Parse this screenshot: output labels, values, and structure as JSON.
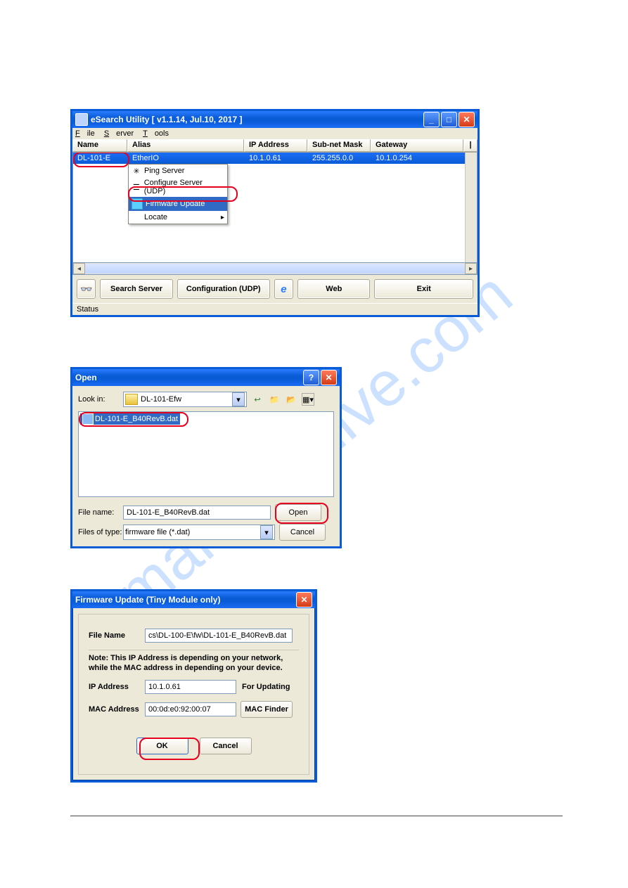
{
  "watermark": "manualshive.com",
  "win1": {
    "title": "eSearch Utility [ v1.1.14, Jul.10, 2017 ]",
    "menu": {
      "file": "File",
      "server": "Server",
      "tools": "Tools"
    },
    "columns": {
      "name": "Name",
      "alias": "Alias",
      "ip": "IP Address",
      "subnet": "Sub-net Mask",
      "gateway": "Gateway",
      "last": "|"
    },
    "row": {
      "name": "DL-101-E",
      "alias": "EtherIO",
      "ip": "10.1.0.61",
      "subnet": "255.255.0.0",
      "gateway": "10.1.0.254"
    },
    "context": {
      "ping": "Ping Server",
      "configure": "Configure Server (UDP)",
      "firmware": "Firmware Update",
      "locate": "Locate"
    },
    "buttons": {
      "search": "Search Server",
      "config": "Configuration (UDP)",
      "web": "Web",
      "exit": "Exit"
    },
    "status": "Status"
  },
  "win2": {
    "title": "Open",
    "lookin_label": "Look in:",
    "lookin_value": "DL-101-Efw",
    "file_selected": "DL-101-E_B40RevB.dat",
    "file_name_label": "File name:",
    "file_name_value": "DL-101-E_B40RevB.dat",
    "type_label": "Files of type:",
    "type_value": "firmware file (*.dat)",
    "open_btn": "Open",
    "cancel_btn": "Cancel"
  },
  "win3": {
    "title": "Firmware Update (Tiny Module only)",
    "file_name_label": "File Name",
    "file_name_value": "cs\\DL-100-E\\fw\\DL-101-E_B40RevB.dat",
    "note_line1": "Note: This IP Address is depending on your network,",
    "note_line2": "while the  MAC address in depending on your device.",
    "ip_label": "IP Address",
    "ip_value": "10.1.0.61",
    "ip_after": "For Updating",
    "mac_label": "MAC Address",
    "mac_value": "00:0d:e0:92:00:07",
    "mac_btn": "MAC Finder",
    "ok": "OK",
    "cancel": "Cancel"
  }
}
